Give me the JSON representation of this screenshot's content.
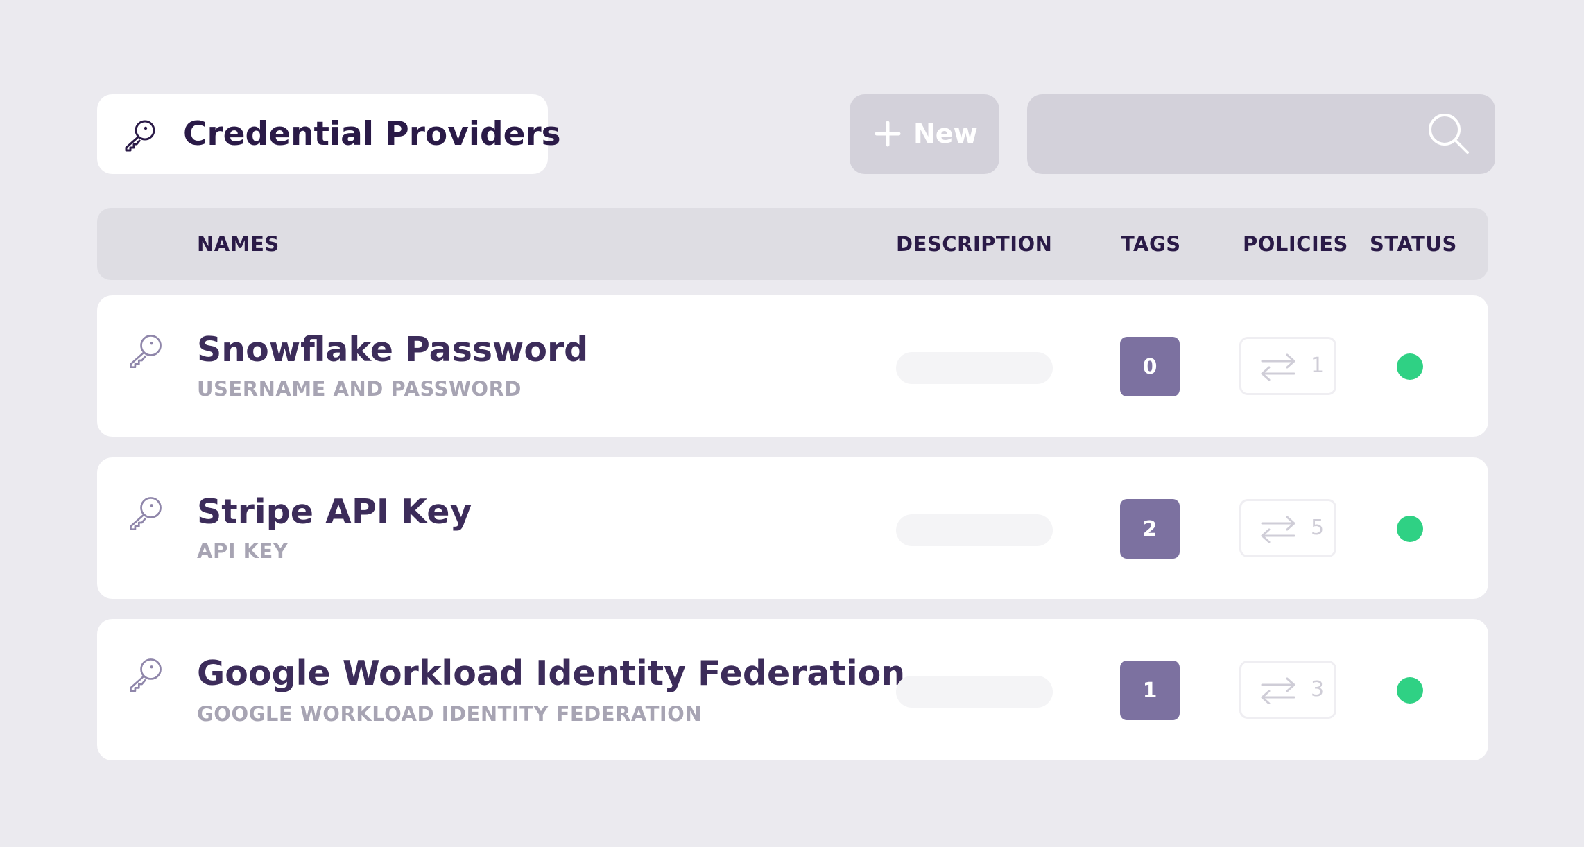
{
  "header": {
    "title": "Credential Providers",
    "new_label": "New",
    "search_placeholder": ""
  },
  "columns": {
    "names": "NAMES",
    "description": "DESCRIPTION",
    "tags": "TAGS",
    "policies": "POLICIES",
    "status": "STATUS"
  },
  "rows": [
    {
      "name": "Snowflake Password",
      "type": "USERNAME AND PASSWORD",
      "tags": "0",
      "policies": "1",
      "status": "active"
    },
    {
      "name": "Stripe API Key",
      "type": "API KEY",
      "tags": "2",
      "policies": "5",
      "status": "active"
    },
    {
      "name": "Google Workload Identity Federation",
      "type": "GOOGLE WORKLOAD IDENTITY FEDERATION",
      "tags": "1",
      "policies": "3",
      "status": "active"
    }
  ],
  "colors": {
    "background": "#ebeaef",
    "tag_badge": "#7c71a0",
    "status_active": "#2fd184",
    "button": "#d3d1da"
  },
  "icons": {
    "title": "key-icon",
    "new": "plus-icon",
    "search": "search-icon",
    "row": "key-icon",
    "policies": "swap-arrows-icon"
  }
}
